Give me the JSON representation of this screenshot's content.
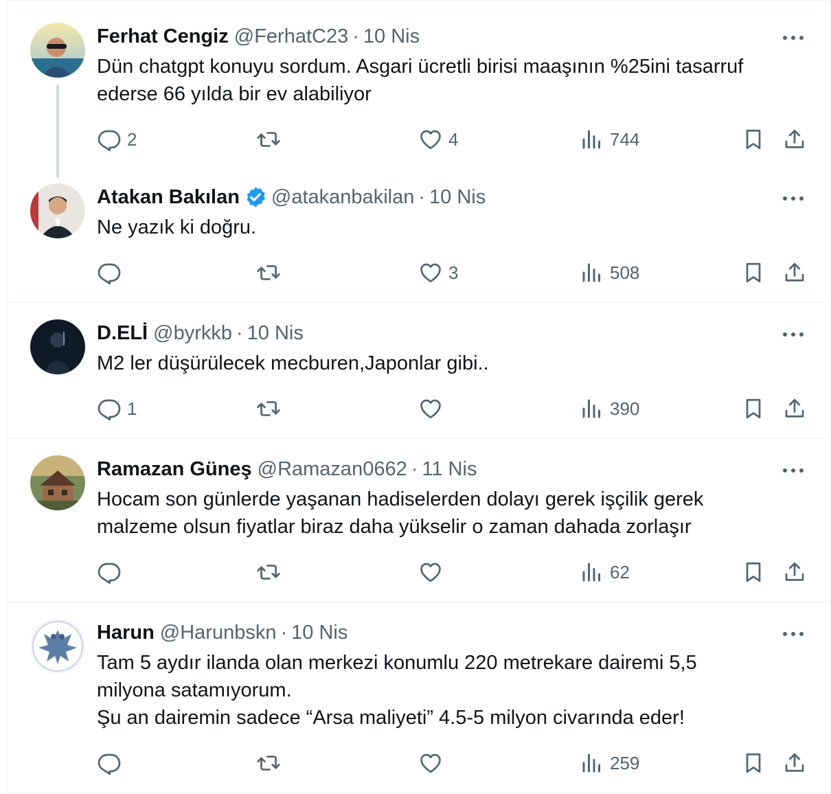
{
  "tweets": [
    {
      "name": "Ferhat Cengiz",
      "verified": false,
      "handle": "@FerhatC23",
      "separator": "·",
      "date": "10 Nis",
      "text": "Dün chatgpt konuyu sordum. Asgari ücretli birisi maaşının %25ini tasarruf\nederse 66 yılda bir ev alabiliyor",
      "replies": "2",
      "retweets": "",
      "likes": "4",
      "views": "744",
      "avatar_icon": "user-avatar-sunglasses-beach"
    },
    {
      "name": "Atakan Bakılan",
      "verified": true,
      "handle": "@atakanbakilan",
      "separator": "·",
      "date": "10 Nis",
      "text": "Ne yazık ki doğru.",
      "replies": "",
      "retweets": "",
      "likes": "3",
      "views": "508",
      "avatar_icon": "user-avatar-suit"
    },
    {
      "name": "D.ELİ",
      "verified": false,
      "handle": "@byrkkb",
      "separator": "·",
      "date": "10 Nis",
      "text": "M2 ler düşürülecek mecburen,Japonlar gibi..",
      "replies": "1",
      "retweets": "",
      "likes": "",
      "views": "390",
      "avatar_icon": "user-avatar-dark-silhouette"
    },
    {
      "name": "Ramazan Güneş",
      "verified": false,
      "handle": "@Ramazan0662",
      "separator": "·",
      "date": "11 Nis",
      "text": "Hocam son günlerde yaşanan hadiselerden dolayı gerek işçilik gerek\nmalzeme olsun fiyatlar biraz daha yükselir o zaman dahada zorlaşır",
      "replies": "",
      "retweets": "",
      "likes": "",
      "views": "62",
      "avatar_icon": "user-avatar-house"
    },
    {
      "name": "Harun",
      "verified": false,
      "handle": "@Harunbskn",
      "separator": "·",
      "date": "10 Nis",
      "text": "Tam 5 aydır ilanda olan merkezi konumlu 220 metrekare dairemi 5,5\nmilyona satamıyorum.\nŞu an dairemin sadece “Arsa maliyeti” 4.5-5 milyon civarında eder!",
      "replies": "",
      "retweets": "",
      "likes": "",
      "views": "259",
      "avatar_icon": "user-avatar-double-headed-eagle"
    }
  ],
  "colors": {
    "text_primary": "#0f1419",
    "text_secondary": "#536471",
    "verified_blue": "#1d9bf0",
    "border": "#eff3f4",
    "thread_line": "#cfd9de"
  },
  "icons": {
    "reply": "reply-icon",
    "retweet": "retweet-icon",
    "like": "heart-icon",
    "views": "views-chart-icon",
    "bookmark": "bookmark-icon",
    "share": "share-icon",
    "more": "more-dots-icon",
    "verified": "verified-badge-icon"
  }
}
